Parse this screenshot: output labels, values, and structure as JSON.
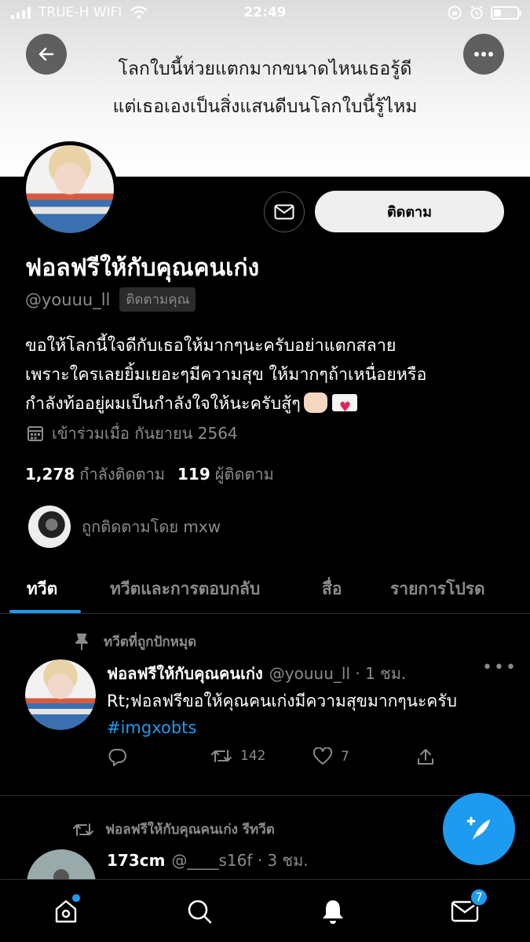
{
  "status_bar": {
    "carrier": "TRUE-H WIFI",
    "time": "22:49"
  },
  "banner": {
    "line1": "โลกใบนี้ห่วยแตกมากขนาดไหนเธอรู้ดี",
    "line2": "แต่เธอเองเป็นสิ่งแสนดีบนโลกใบนี้รู้ไหม"
  },
  "profile": {
    "display_name": "ฟอลฟรีให้กับคุณคนเก่ง",
    "handle": "@youuu_ll",
    "follows_you": "ติดตามคุณ",
    "follow_button": "ติดตาม",
    "bio_line1": "ขอให้โลกนี้ใจดีกับเธอให้มากๆนะครับอย่าแตกสลาย",
    "bio_line2": "เพราะใครเลยยิ้มเยอะๆมีความสุข ให้มากๆถ้าเหนื่อยหรือ",
    "bio_line3": "กำลังท้ออยู่ผมเป็นกำลังใจให้นะครับสู้ๆ",
    "joined": "เข้าร่วมเมื่อ กันยายน 2564",
    "following_count": "1,278",
    "following_label": "กำลังติดตาม",
    "followers_count": "119",
    "followers_label": "ผู้ติดตาม",
    "followed_by": "ถูกติดตามโดย mxw"
  },
  "tabs": [
    "ทวีต",
    "ทวีตและการตอบกลับ",
    "สื่อ",
    "รายการโปรด"
  ],
  "pinned_tweet": {
    "pinned_label": "ทวีตที่ถูกปักหมุด",
    "author": "ฟอลฟรีให้กับคุณคนเก่ง",
    "handle_time": "@youuu_ll · 1 ชม.",
    "text": "Rt;ฟอลฟรีขอให้คุณคนเก่งมีความสุขมากๆนะครับ ",
    "hashtag": "#imgxobts",
    "retweets": "142",
    "likes": "7"
  },
  "retweet": {
    "label": "ฟอลฟรีให้กับคุณคนเก่ง รีทวีต",
    "author": "173cm",
    "handle_time": "@____s16f · 3 ชม."
  },
  "nav": {
    "messages_badge": "7"
  },
  "colors": {
    "accent": "#1d9bf0",
    "background": "#000000",
    "muted": "#8b8b8b"
  }
}
